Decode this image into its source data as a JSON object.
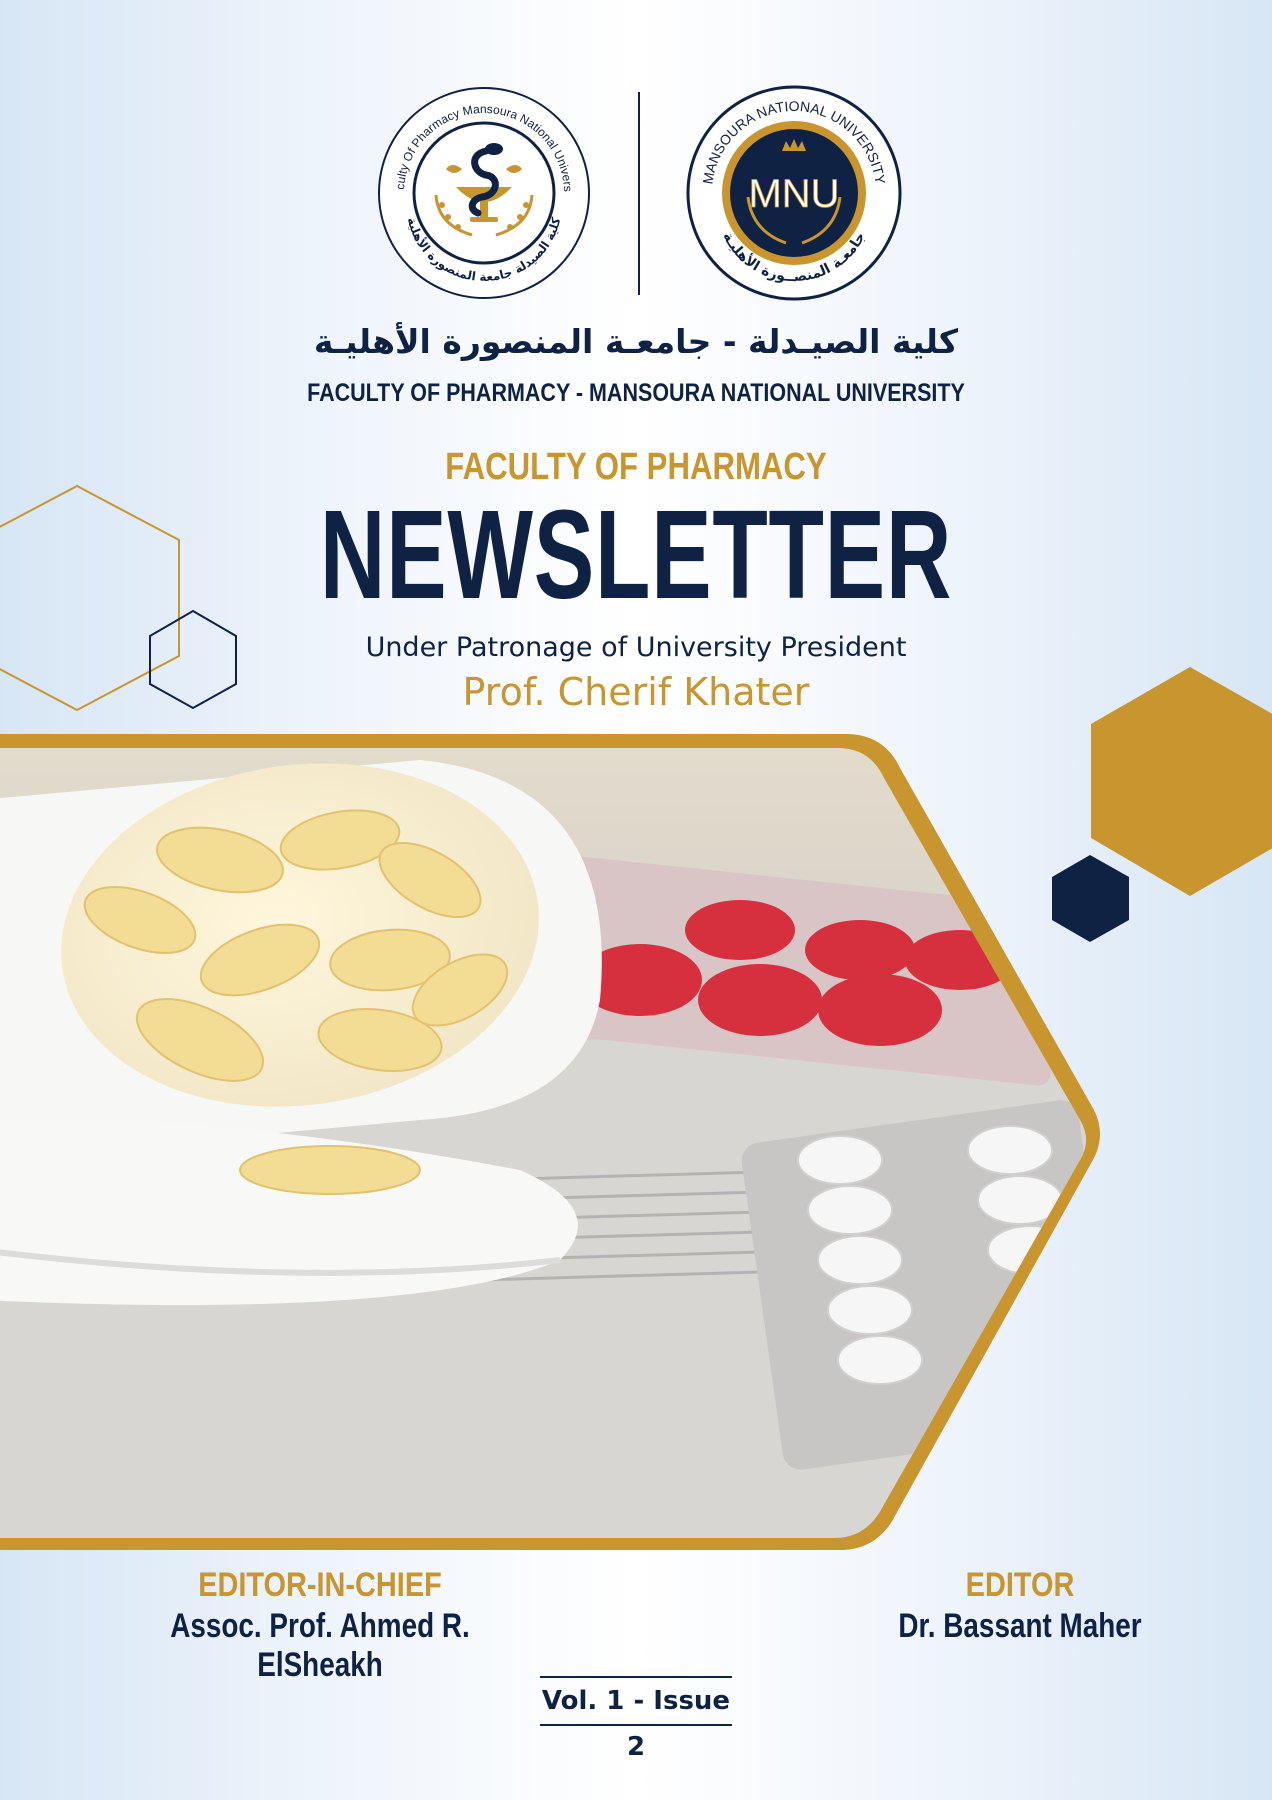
{
  "header": {
    "pharmacy_seal": {
      "ring_text": "Faculty Of Pharmacy Mansoura National University",
      "ring_text_ar": "كلية الصيدلة جامعة المنصورة الأهلية"
    },
    "university_seal": {
      "ring_text": "MANSOURA NATIONAL UNIVERSITY",
      "ring_text_ar": "جامعـة المنصــورة الأهليـة",
      "monogram": "MNU"
    },
    "arabic_title": "كلية الصيـدلة - جامعـة المنصورة الأهليـة",
    "english_title": "FACULTY OF PHARMACY - MANSOURA NATIONAL UNIVERSITY"
  },
  "masthead": {
    "kicker": "FACULTY OF PHARMACY",
    "title": "NEWSLETTER",
    "patronage": "Under Patronage of University President",
    "president": "Prof. Cherif Khater"
  },
  "credits": {
    "editor_in_chief_label": "EDITOR-IN-CHIEF",
    "editor_in_chief_name": "Assoc. Prof. Ahmed R. ElSheakh",
    "editor_label": "EDITOR",
    "editor_name": "Dr. Bassant Maher"
  },
  "issue": "Vol. 1 - Issue 2",
  "colors": {
    "navy": "#0f2244",
    "gold": "#c8952e",
    "background": "#eef4fb"
  }
}
